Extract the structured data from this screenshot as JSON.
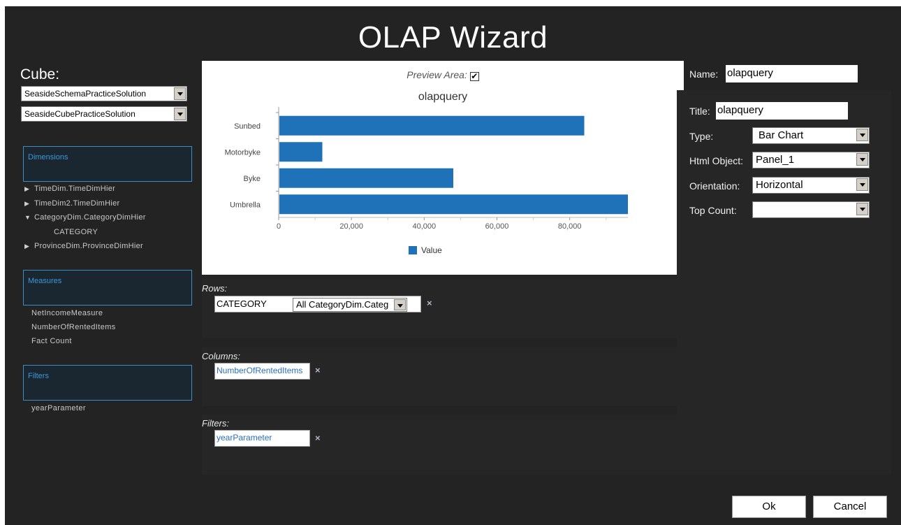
{
  "app": {
    "title": "OLAP Wizard"
  },
  "left": {
    "cube_label": "Cube:",
    "schema_select": "SeasideSchemaPracticeSolution",
    "cube_select": "SeasideCubePracticeSolution",
    "dimensions_title": "Dimensions",
    "dimensions": [
      {
        "label": "TimeDim.TimeDimHier",
        "arrow": "▶"
      },
      {
        "label": "TimeDim2.TimeDimHier",
        "arrow": "▶"
      },
      {
        "label": "CategoryDim.CategoryDimHier",
        "arrow": "▼"
      },
      {
        "label": "CATEGORY",
        "arrow": ""
      },
      {
        "label": "ProvinceDim.ProvinceDimHier",
        "arrow": "▶"
      }
    ],
    "measures_title": "Measures",
    "measures": [
      "NetIncomeMeasure",
      "NumberOfRentedItems",
      "Fact Count"
    ],
    "filters_title": "Filters",
    "filters": [
      "yearParameter"
    ]
  },
  "preview": {
    "label": "Preview Area:",
    "checked": "✔"
  },
  "chart_data": {
    "type": "bar",
    "orientation": "horizontal",
    "title": "olapquery",
    "categories": [
      "Sunbed",
      "Motorbyke",
      "Byke",
      "Umbrella"
    ],
    "category_labels_shown": [
      "Sunbed",
      "Motorbyke",
      "Byke",
      "  Umbrella"
    ],
    "series": [
      {
        "name": "Value",
        "values": [
          84000,
          12000,
          48000,
          96000
        ]
      }
    ],
    "xlim": [
      0,
      96000
    ],
    "xticks": [
      0,
      20000,
      40000,
      60000,
      80000
    ],
    "xtick_labels": [
      "0",
      "20,000",
      "40,000",
      "60,000",
      "80,000"
    ],
    "legend_position": "bottom",
    "color": "#1f72b8"
  },
  "rows": {
    "label": "Rows:",
    "field": "CATEGORY",
    "member_select": "All CategoryDim.Categ",
    "remove": "×"
  },
  "columns": {
    "label": "Columns:",
    "field": "NumberOfRentedItems",
    "remove": "×"
  },
  "filters_area": {
    "label": "Filters:",
    "field": "yearParameter",
    "remove": "×"
  },
  "right": {
    "name_label": "Name:",
    "name_value": "olapquery",
    "title_label": "Title:",
    "title_value": "olapquery",
    "type_label": "Type:",
    "type_value": "Bar Chart",
    "html_object_label": "Html Object:",
    "html_object_value": "Panel_1",
    "orientation_label": "Orientation:",
    "orientation_value": "Horizontal",
    "top_count_label": "Top Count:",
    "top_count_value": ""
  },
  "footer": {
    "ok": "Ok",
    "cancel": "Cancel"
  }
}
